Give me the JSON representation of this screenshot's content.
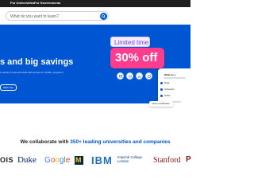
{
  "topbar": {
    "links": [
      "For Universities",
      "For Governments"
    ]
  },
  "search": {
    "placeholder": "What do you want to learn?"
  },
  "hero": {
    "headline": "s and big savings",
    "subtext": "s explore in-demand skills with access to 10,000+ programs",
    "cta_label": "Start Free"
  },
  "promo": {
    "limited_label": "Limited time",
    "discount_label": "30% off",
    "earn_label": "Earn certificates"
  },
  "card": {
    "title": "What do y",
    "items": [
      "Data",
      "Cybersec",
      "Softw"
    ]
  },
  "collaborate": {
    "prefix": "We collaborate with ",
    "highlight": "350+ leading universities and companies"
  },
  "partners": {
    "ois": "OIS",
    "duke": "Duke",
    "google": "Google",
    "michigan": "M",
    "ibm": "IBM",
    "imperial_line1": "Imperial College",
    "imperial_line2": "London",
    "stanford": "Stanford",
    "partial": "P"
  },
  "colors": {
    "brand_blue": "#0056d2",
    "promo_pink": "#ff3c8e",
    "promo_purple": "#7b3fe4"
  }
}
